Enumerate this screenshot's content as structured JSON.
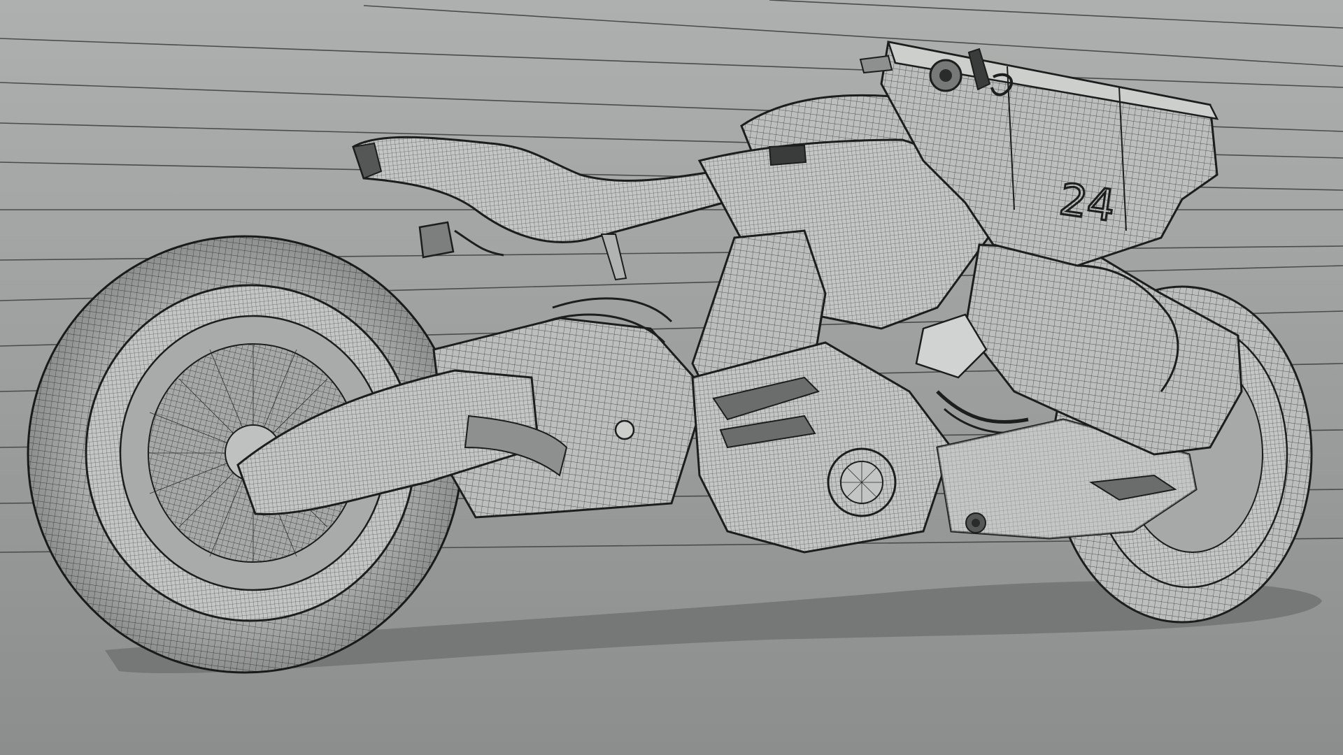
{
  "scene": {
    "subject": "motorcycle-wireframe-render",
    "race_number": "24",
    "colors": {
      "background_top": "#aaacab",
      "background_bottom": "#8d8f8f",
      "surface": "#b9bbba",
      "surface_light": "#cdcfcd",
      "surface_dark": "#8e908f",
      "wire": "#2a2c2c",
      "outline": "#1c1d1d",
      "shadow": "#6e706f",
      "backdrop_line": "#4a4c4c"
    }
  }
}
